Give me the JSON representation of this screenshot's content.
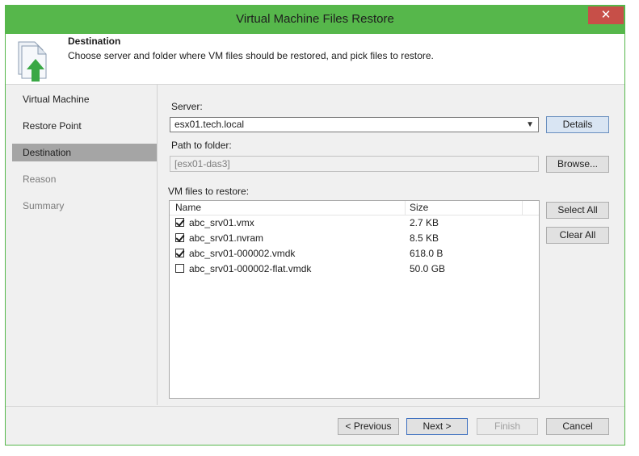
{
  "window": {
    "title": "Virtual Machine Files Restore",
    "close_glyph": "✕"
  },
  "header": {
    "title": "Destination",
    "description": "Choose server and folder where VM files should be restored, and pick files to restore.",
    "icon": "restore-document-icon"
  },
  "nav": {
    "items": [
      {
        "label": "Virtual Machine",
        "state": "normal"
      },
      {
        "label": "Restore Point",
        "state": "normal"
      },
      {
        "label": "Destination",
        "state": "active"
      },
      {
        "label": "Reason",
        "state": "disabled"
      },
      {
        "label": "Summary",
        "state": "disabled"
      }
    ]
  },
  "form": {
    "server_label": "Server:",
    "server_value": "esx01.tech.local",
    "details_button": "Details",
    "path_label": "Path to folder:",
    "path_value": "[esx01-das3]",
    "browse_button": "Browse...",
    "files_label": "VM files to restore:",
    "select_all_button": "Select All",
    "clear_all_button": "Clear All"
  },
  "files": {
    "columns": {
      "name": "Name",
      "size": "Size"
    },
    "rows": [
      {
        "name": "abc_srv01.vmx",
        "size": "2.7 KB",
        "checked": true
      },
      {
        "name": "abc_srv01.nvram",
        "size": "8.5 KB",
        "checked": true
      },
      {
        "name": "abc_srv01-000002.vmdk",
        "size": "618.0 B",
        "checked": true
      },
      {
        "name": "abc_srv01-000002-flat.vmdk",
        "size": "50.0 GB",
        "checked": false
      }
    ]
  },
  "footer": {
    "previous_button": "< Previous",
    "next_button": "Next >",
    "finish_button": "Finish",
    "cancel_button": "Cancel"
  },
  "colors": {
    "window_frame": "#56b74b",
    "close_button": "#c74f48",
    "active_nav": "#a5a5a5",
    "icon_arrow": "#3aa845"
  }
}
